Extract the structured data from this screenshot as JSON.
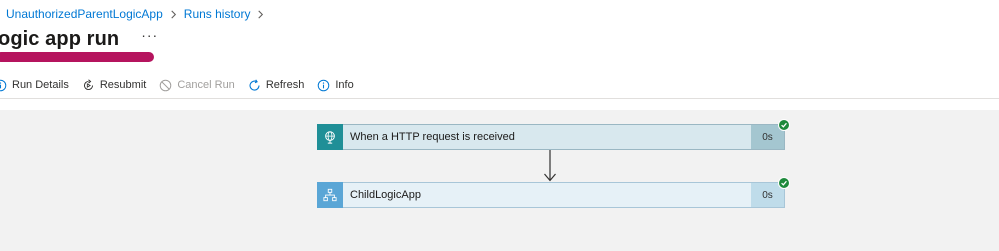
{
  "breadcrumb": {
    "items": [
      {
        "label": "UnauthorizedParentLogicApp"
      },
      {
        "label": "Runs history"
      }
    ]
  },
  "header": {
    "title": "ogic app run",
    "more": "···"
  },
  "toolbar": {
    "run_details": "Run Details",
    "resubmit": "Resubmit",
    "cancel_run": "Cancel Run",
    "refresh": "Refresh",
    "info": "Info"
  },
  "steps": [
    {
      "title": "When a HTTP request is received",
      "duration": "0s",
      "status": "succeeded",
      "icon": "http-request-icon"
    },
    {
      "title": "ChildLogicApp",
      "duration": "0s",
      "status": "succeeded",
      "icon": "workflow-icon"
    }
  ],
  "colors": {
    "link": "#0078d4",
    "http_icon_bg": "#1f8f97",
    "child_icon_bg": "#5aa6d6",
    "success": "#1e8a3c",
    "redaction": "#b5145e"
  }
}
